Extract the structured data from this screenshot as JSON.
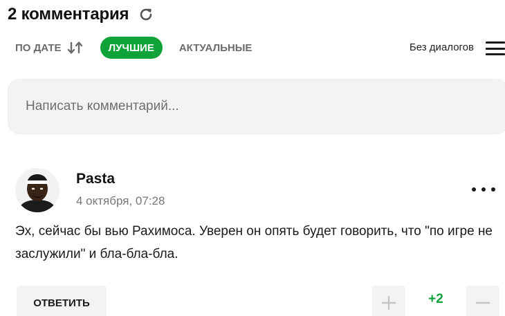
{
  "header": {
    "title": "2 комментария",
    "refresh_icon": "refresh-icon"
  },
  "filters": {
    "by_date": "ПО ДАТЕ",
    "best": "ЛУЧШИЕ",
    "actual": "АКТУАЛЬНЫЕ",
    "no_dialogs": "Без диалогов",
    "active": "best",
    "active_color": "#0fa239"
  },
  "comment_input": {
    "placeholder": "Написать комментарий..."
  },
  "comment": {
    "author": "Pasta",
    "date": "4 октября, 07:28",
    "text": "Эх, сейчас бы вью Рахимоса. Уверен он опять будет говорить, что \"по игре не заслужили\" и бла-бла-бла.",
    "reply_label": "ОТВЕТИТЬ",
    "score": "+2",
    "score_color": "#0fa239"
  }
}
